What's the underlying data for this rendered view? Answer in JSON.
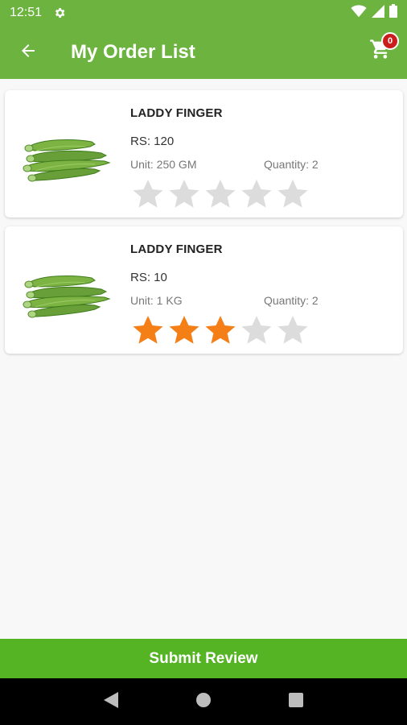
{
  "status_bar": {
    "time": "12:51"
  },
  "app_bar": {
    "title": "My Order List",
    "cart_count": "0"
  },
  "orders": [
    {
      "name": "LADDY FINGER",
      "price": "RS: 120",
      "unit": "Unit: 250 GM",
      "quantity": "Quantity: 2",
      "rating": 0,
      "max_rating": 5
    },
    {
      "name": "LADDY FINGER",
      "price": "RS: 10",
      "unit": "Unit: 1 KG",
      "quantity": "Quantity: 2",
      "rating": 3,
      "max_rating": 5
    }
  ],
  "submit_label": "Submit Review",
  "colors": {
    "primary": "#6cb33f",
    "button": "#55b424",
    "star_filled": "#f57f17",
    "star_empty": "#dcdcdc",
    "badge": "#cc1d1d"
  },
  "icons": {
    "back": "arrow-left-icon",
    "cart": "cart-icon",
    "settings": "gear-icon",
    "wifi": "wifi-icon",
    "signal": "signal-icon",
    "battery": "battery-icon",
    "nav_back": "triangle-back-icon",
    "nav_home": "circle-home-icon",
    "nav_recents": "square-recents-icon"
  }
}
